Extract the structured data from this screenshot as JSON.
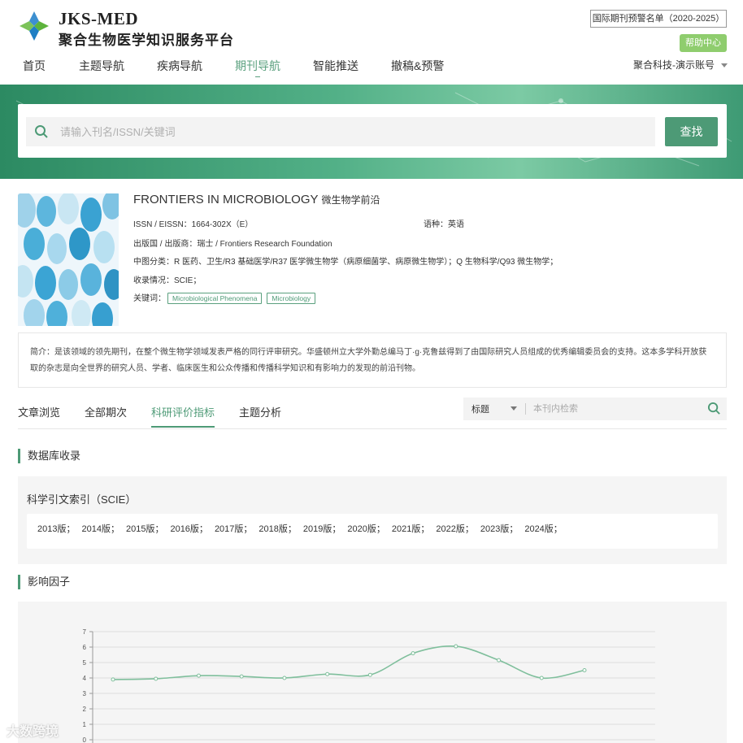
{
  "header": {
    "brand_en": "JKS-MED",
    "brand_cn": "聚合生物医学知识服务平台",
    "warning_list_label": "国际期刊预警名单（2020-2025）",
    "help_label": "帮助中心",
    "account_label": "聚合科技-演示账号",
    "nav": [
      {
        "label": "首页"
      },
      {
        "label": "主题导航"
      },
      {
        "label": "疾病导航"
      },
      {
        "label": "期刊导航"
      },
      {
        "label": "智能推送"
      },
      {
        "label": "撤稿&预警"
      }
    ],
    "active_nav": "期刊导航"
  },
  "search": {
    "placeholder": "请输入刊名/ISSN/关键词",
    "value": "",
    "button_label": "查找"
  },
  "journal": {
    "title_en": "FRONTIERS IN MICROBIOLOGY",
    "title_cn": "微生物学前沿",
    "issn": "ISSN / EISSN：1664-302X（E）",
    "language": "语种：英语",
    "publisher": "出版国 / 出版商：瑞士 / Frontiers Research Foundation",
    "classification": "中图分类：R 医药、卫生/R3 基础医学/R37 医学微生物学（病原细菌学、病原微生物学）；Q 生物科学/Q93 微生物学；",
    "indexed": "收录情况：SCIE；",
    "keywords_label": "关键词：",
    "keywords": [
      "Microbiological Phenomena",
      "Microbiology"
    ],
    "intro": "简介：是该领域的领先期刊，在整个微生物学领域发表严格的同行评审研究。华盛顿州立大学外勤总编马丁·g·克鲁兹得到了由国际研究人员组成的优秀编辑委员会的支持。这本多学科开放获取的杂志是向全世界的研究人员、学者、临床医生和公众传播和传播科学知识和有影响力的发现的前沿刊物。"
  },
  "tabs": [
    {
      "label": "文章浏览"
    },
    {
      "label": "全部期次"
    },
    {
      "label": "科研评价指标"
    },
    {
      "label": "主题分析"
    }
  ],
  "active_tab": "科研评价指标",
  "inner_search": {
    "select_value": "标题",
    "placeholder": "本刊内检索"
  },
  "database_section": {
    "title": "数据库收录",
    "db_name": "科学引文索引（SCIE）",
    "years": [
      "2013版；",
      "2014版；",
      "2015版；",
      "2016版；",
      "2017版；",
      "2018版；",
      "2019版；",
      "2020版；",
      "2021版；",
      "2022版；",
      "2023版；",
      "2024版；"
    ]
  },
  "impact_section": {
    "title": "影响因子"
  },
  "chart_data": {
    "type": "line",
    "title": "",
    "xlabel": "",
    "ylabel": "",
    "ylim": [
      0,
      7
    ],
    "yticks": [
      0,
      1,
      2,
      3,
      4,
      5,
      6,
      7
    ],
    "x": [
      1,
      2,
      3,
      4,
      5,
      6,
      7,
      8,
      9,
      10,
      11,
      12
    ],
    "series": [
      {
        "values": [
          3.9,
          3.95,
          4.15,
          4.1,
          4.0,
          4.25,
          4.2,
          5.6,
          6.05,
          5.15,
          4.0,
          4.5
        ]
      }
    ],
    "grid": true,
    "line_color": "#7fbf9c"
  },
  "watermark": "大数跨境"
}
